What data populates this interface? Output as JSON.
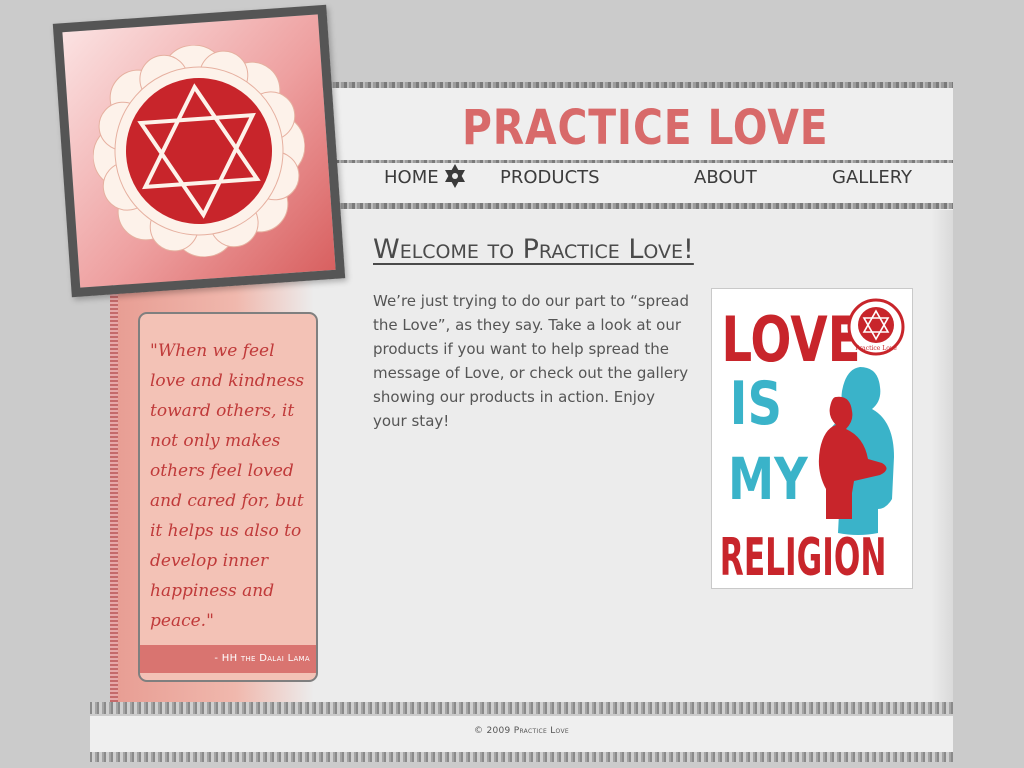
{
  "site": {
    "logo_text": "PRACTICE LOVE"
  },
  "nav": {
    "items": [
      {
        "label": "HOME"
      },
      {
        "label": "PRODUCTS"
      },
      {
        "label": "ABOUT"
      },
      {
        "label": "GALLERY"
      }
    ]
  },
  "sidebar": {
    "quote": "\"When we feel love and kindness toward others, it not only makes others feel loved and cared for, but it helps us also to develop inner happiness and peace.\"",
    "attribution": "- HH the Dalai Lama"
  },
  "main": {
    "heading": "Welcome to Practice Love!",
    "intro": "We’re just trying to do our part to “spread the Love”, as they say.  Take a look at our products if you want to help spread the message of Love, or check out the gallery showing our products in action.  Enjoy your stay!"
  },
  "poster": {
    "line1": "LOVE",
    "line2": "IS",
    "line3": "MY",
    "line4": "RELIGION",
    "seal_text": "Practice Love"
  },
  "footer": {
    "copyright": "© 2009 Practice Love"
  },
  "colors": {
    "brand_red": "#c8252b",
    "brand_pink": "#d86a6a",
    "poster_teal": "#3ab3c9",
    "text_gray": "#555555"
  },
  "icons": {
    "nav_active": "star-of-david-icon",
    "logo": "star-of-david-lotus-icon"
  }
}
